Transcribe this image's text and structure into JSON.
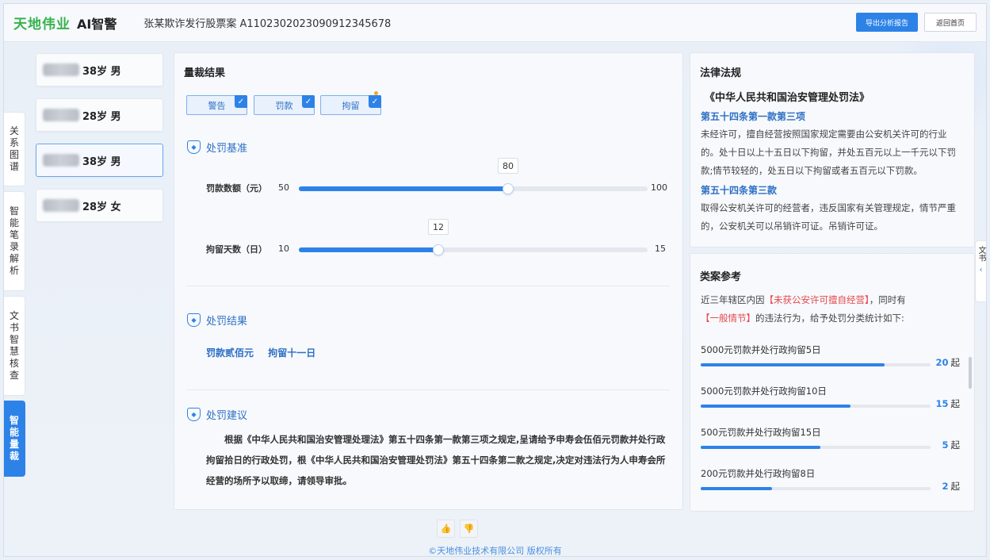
{
  "header": {
    "brand": "天地伟业",
    "brand_sub": "AI智警",
    "case_title": "张某欺诈发行股票案 A1102302023090912345678",
    "export_label": "导出分析报告",
    "home_label": "返回首页"
  },
  "vtabs": [
    {
      "label": "关系图谱",
      "active": false
    },
    {
      "label": "智能笔录解析",
      "active": false
    },
    {
      "label": "文书智慧核查",
      "active": false
    },
    {
      "label": "智能量裁",
      "active": true
    }
  ],
  "people": [
    {
      "info": "38岁 男",
      "active": false
    },
    {
      "info": "28岁 男",
      "active": false
    },
    {
      "info": "38岁 男",
      "active": true
    },
    {
      "info": "28岁 女",
      "active": false
    }
  ],
  "main": {
    "title": "量裁结果",
    "chips": [
      "警告",
      "罚款",
      "拘留"
    ],
    "basis_title": "处罚基准",
    "sliders": [
      {
        "label": "罚款数额（元）",
        "min": "50",
        "max": "100",
        "value": "80",
        "fraction": 0.6
      },
      {
        "label": "拘留天数（日）",
        "min": "10",
        "max": "15",
        "value": "12",
        "fraction": 0.4
      }
    ],
    "result_title": "处罚结果",
    "results": [
      "罚款贰佰元",
      "拘留十一日"
    ],
    "advice_title": "处罚建议",
    "advice_text": "根据《中华人民共和国治安管理处理法》第五十四条第一款第三项之规定,呈请给予申寿会伍佰元罚款并处行政拘留拾日的行政处罚，根《中华人民共和国治安管理处罚法》第五十四条第二款之规定,决定对违法行为人申寿会所经营的场所予以取缔，请领导审批。"
  },
  "law": {
    "title": "法律法规",
    "name": "《中华人民共和国治安管理处罚法》",
    "clause1": "第五十四条第一款第三项",
    "text1": "未经许可，擅自经营按照国家规定需要由公安机关许可的行业的。处十日以上十五日以下拘留，并处五百元以上一千元以下罚款;情节较轻的，处五日以下拘留或者五百元以下罚款。",
    "clause2": "第五十四条第三款",
    "text2": "取得公安机关许可的经营者，违反国家有关管理规定，情节严重的，公安机关可以吊销许可证。吊销许可证。"
  },
  "cases": {
    "title": "类案参考",
    "desc_pre": "近三年辖区内因",
    "desc_hl1": "【未获公安许可擅自经营】",
    "desc_mid": "，同时有",
    "desc_hl2": "【一般情节】",
    "desc_post": "的违法行为，给予处罚分类统计如下:",
    "unit": "起",
    "stats": [
      {
        "label": "5000元罚款并处行政拘留5日",
        "count": "20",
        "fraction": 0.8
      },
      {
        "label": "5000元罚款并处行政拘留10日",
        "count": "15",
        "fraction": 0.65
      },
      {
        "label": "500元罚款并处行政拘留15日",
        "count": "5",
        "fraction": 0.52
      },
      {
        "label": "200元罚款并处行政拘留8日",
        "count": "2",
        "fraction": 0.31
      }
    ]
  },
  "side_tab": {
    "label": "文书",
    "arrow": "‹"
  },
  "footer": {
    "like": "👍",
    "dislike": "👎",
    "copyright": "©天地伟业技术有限公司 版权所有"
  },
  "colors": {
    "accent": "#2d82e8",
    "brand": "#37b24d",
    "highlight": "#e5484d"
  }
}
